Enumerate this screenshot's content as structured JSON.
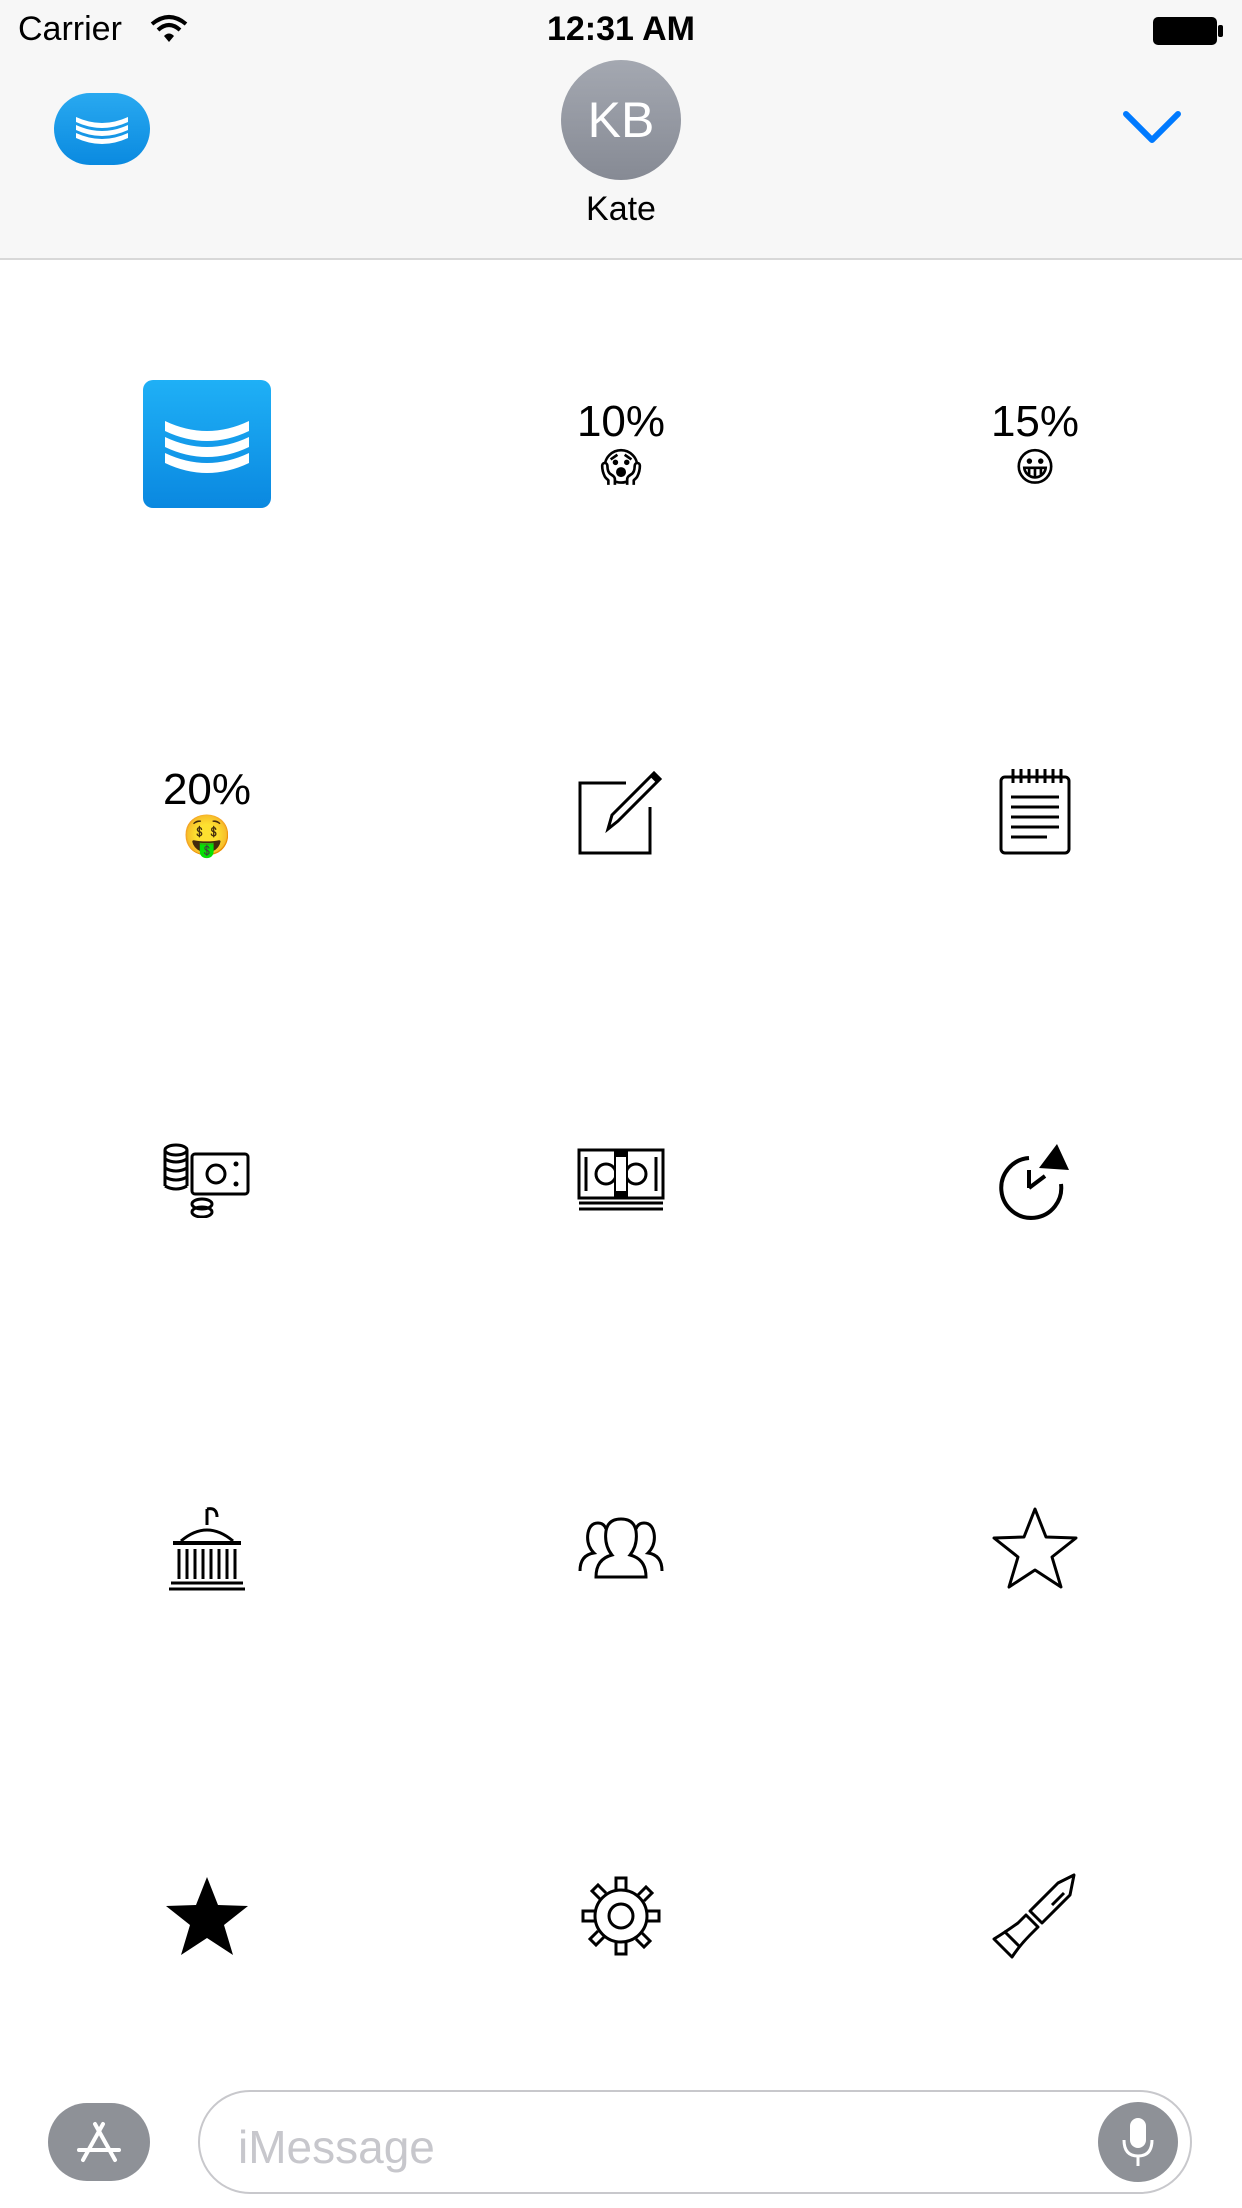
{
  "status_bar": {
    "carrier": "Carrier",
    "time": "12:31 AM"
  },
  "header": {
    "avatar_initials": "KB",
    "contact_name": "Kate"
  },
  "grid": {
    "tips": [
      {
        "percent": "10%",
        "emoji": "😱"
      },
      {
        "percent": "15%",
        "emoji": "😀"
      },
      {
        "percent": "20%",
        "emoji": "🤑"
      }
    ],
    "icons": [
      "app-icon",
      "tip-10-sticker",
      "tip-15-sticker",
      "tip-20-sticker",
      "compose-icon",
      "notepad-icon",
      "coins-cash-icon",
      "money-stack-icon",
      "pie-chart-icon",
      "government-building-icon",
      "people-group-icon",
      "star-outline-icon",
      "star-filled-icon",
      "gear-icon",
      "paintbrush-icon"
    ]
  },
  "bottom_bar": {
    "placeholder": "iMessage"
  },
  "colors": {
    "accent": "#007aff",
    "app_blue": "#0a8ae0",
    "avatar_gray": "#8e9197"
  }
}
